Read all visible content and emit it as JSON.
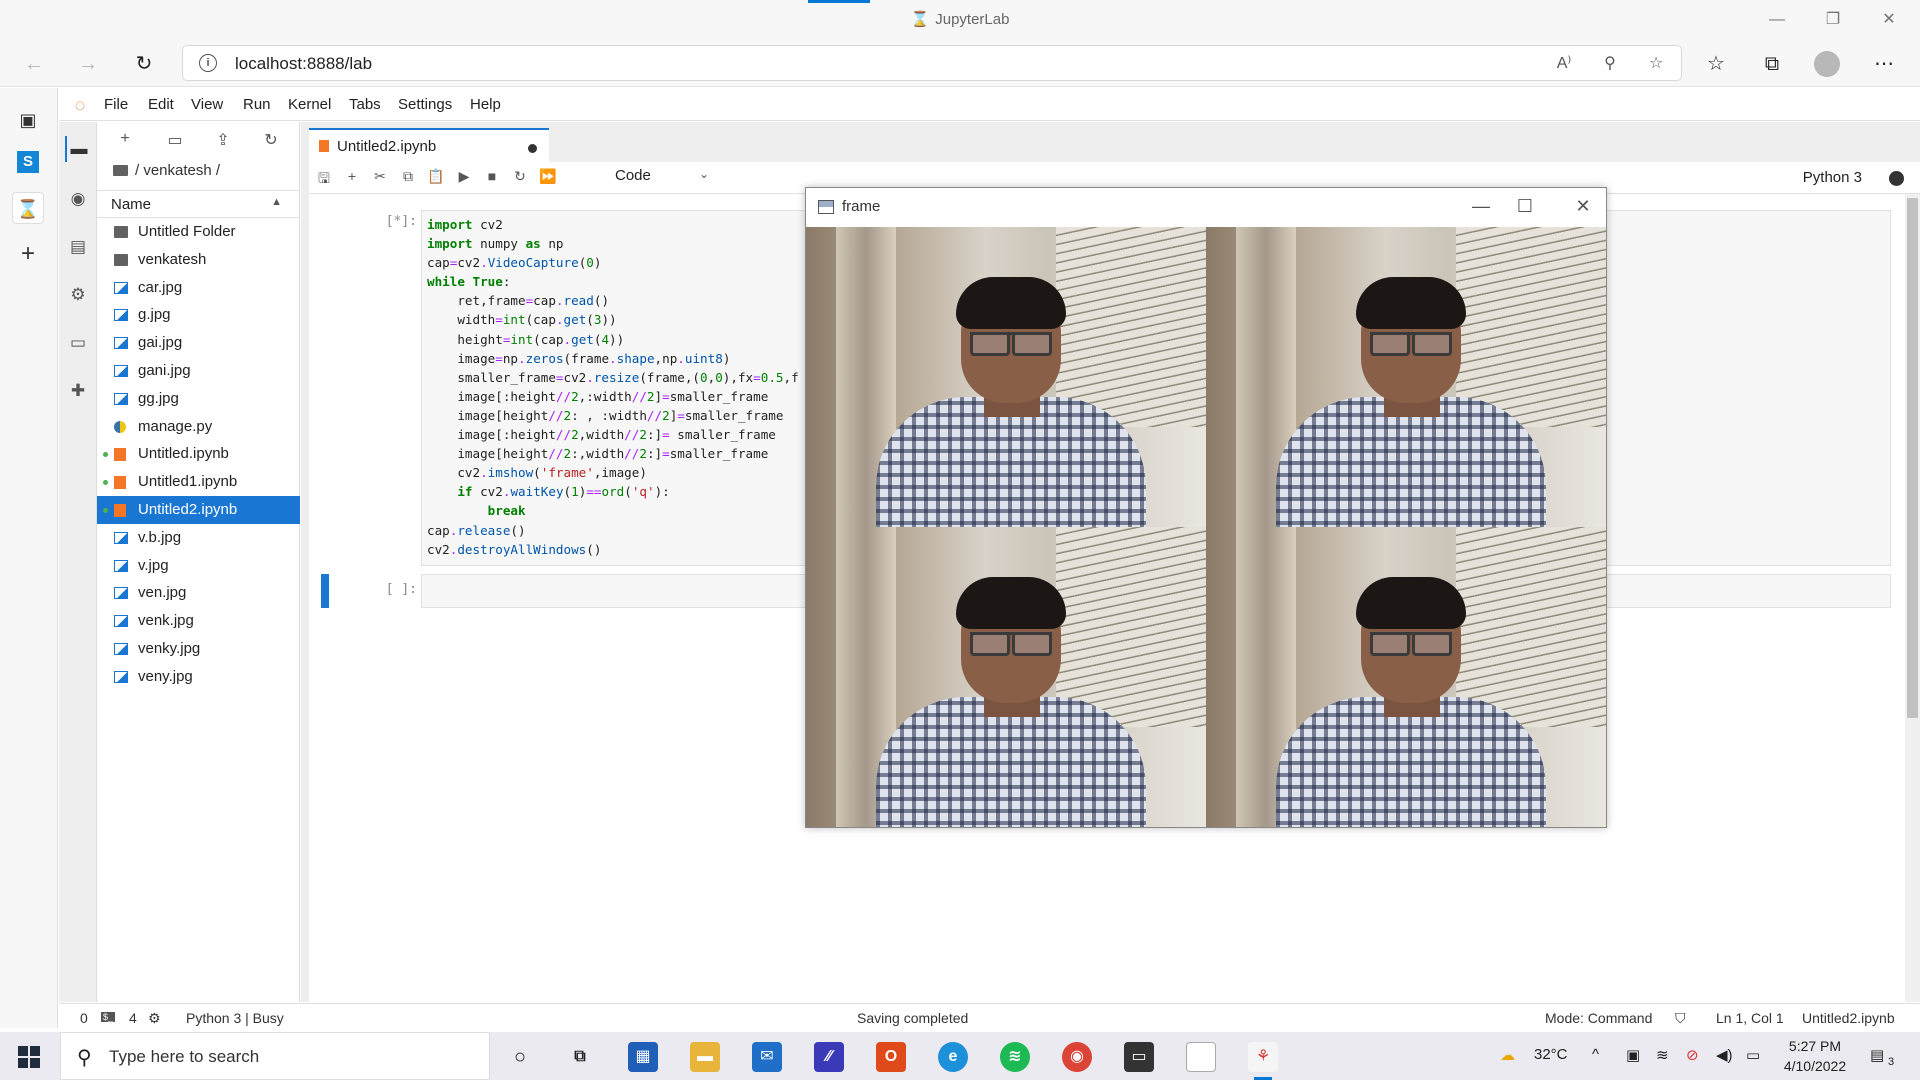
{
  "browser": {
    "window_title": "JupyterLab",
    "url": "localhost:8888/lab"
  },
  "jupyter": {
    "menu": [
      "File",
      "Edit",
      "View",
      "Run",
      "Kernel",
      "Tabs",
      "Settings",
      "Help"
    ],
    "breadcrumb": "/ venkatesh /",
    "file_header": "Name",
    "files": [
      {
        "name": "Untitled Folder",
        "type": "folder"
      },
      {
        "name": "venkatesh",
        "type": "folder"
      },
      {
        "name": "car.jpg",
        "type": "image"
      },
      {
        "name": "g.jpg",
        "type": "image"
      },
      {
        "name": "gai.jpg",
        "type": "image"
      },
      {
        "name": "gani.jpg",
        "type": "image"
      },
      {
        "name": "gg.jpg",
        "type": "image"
      },
      {
        "name": "manage.py",
        "type": "python"
      },
      {
        "name": "Untitled.ipynb",
        "type": "notebook",
        "running": true
      },
      {
        "name": "Untitled1.ipynb",
        "type": "notebook",
        "running": true
      },
      {
        "name": "Untitled2.ipynb",
        "type": "notebook",
        "running": true,
        "selected": true
      },
      {
        "name": "v.b.jpg",
        "type": "image"
      },
      {
        "name": "v.jpg",
        "type": "image"
      },
      {
        "name": "ven.jpg",
        "type": "image"
      },
      {
        "name": "venk.jpg",
        "type": "image"
      },
      {
        "name": "venky.jpg",
        "type": "image"
      },
      {
        "name": "veny.jpg",
        "type": "image"
      }
    ],
    "tab_name": "Untitled2.ipynb",
    "cell_type": "Code",
    "kernel_name": "Python 3",
    "cells": [
      {
        "prompt": "[*]:"
      },
      {
        "prompt": "[ ]:"
      }
    ],
    "status": {
      "terminals": "0",
      "kernels": "4",
      "kernel_state": "Python 3 | Busy",
      "message": "Saving completed",
      "mode": "Mode: Command",
      "position": "Ln 1, Col 1",
      "file": "Untitled2.ipynb"
    }
  },
  "cv_window": {
    "title": "frame"
  },
  "taskbar": {
    "search_placeholder": "Type here to search",
    "weather": "32°C",
    "time": "5:27 PM",
    "date": "4/10/2022",
    "notifications": "3"
  }
}
